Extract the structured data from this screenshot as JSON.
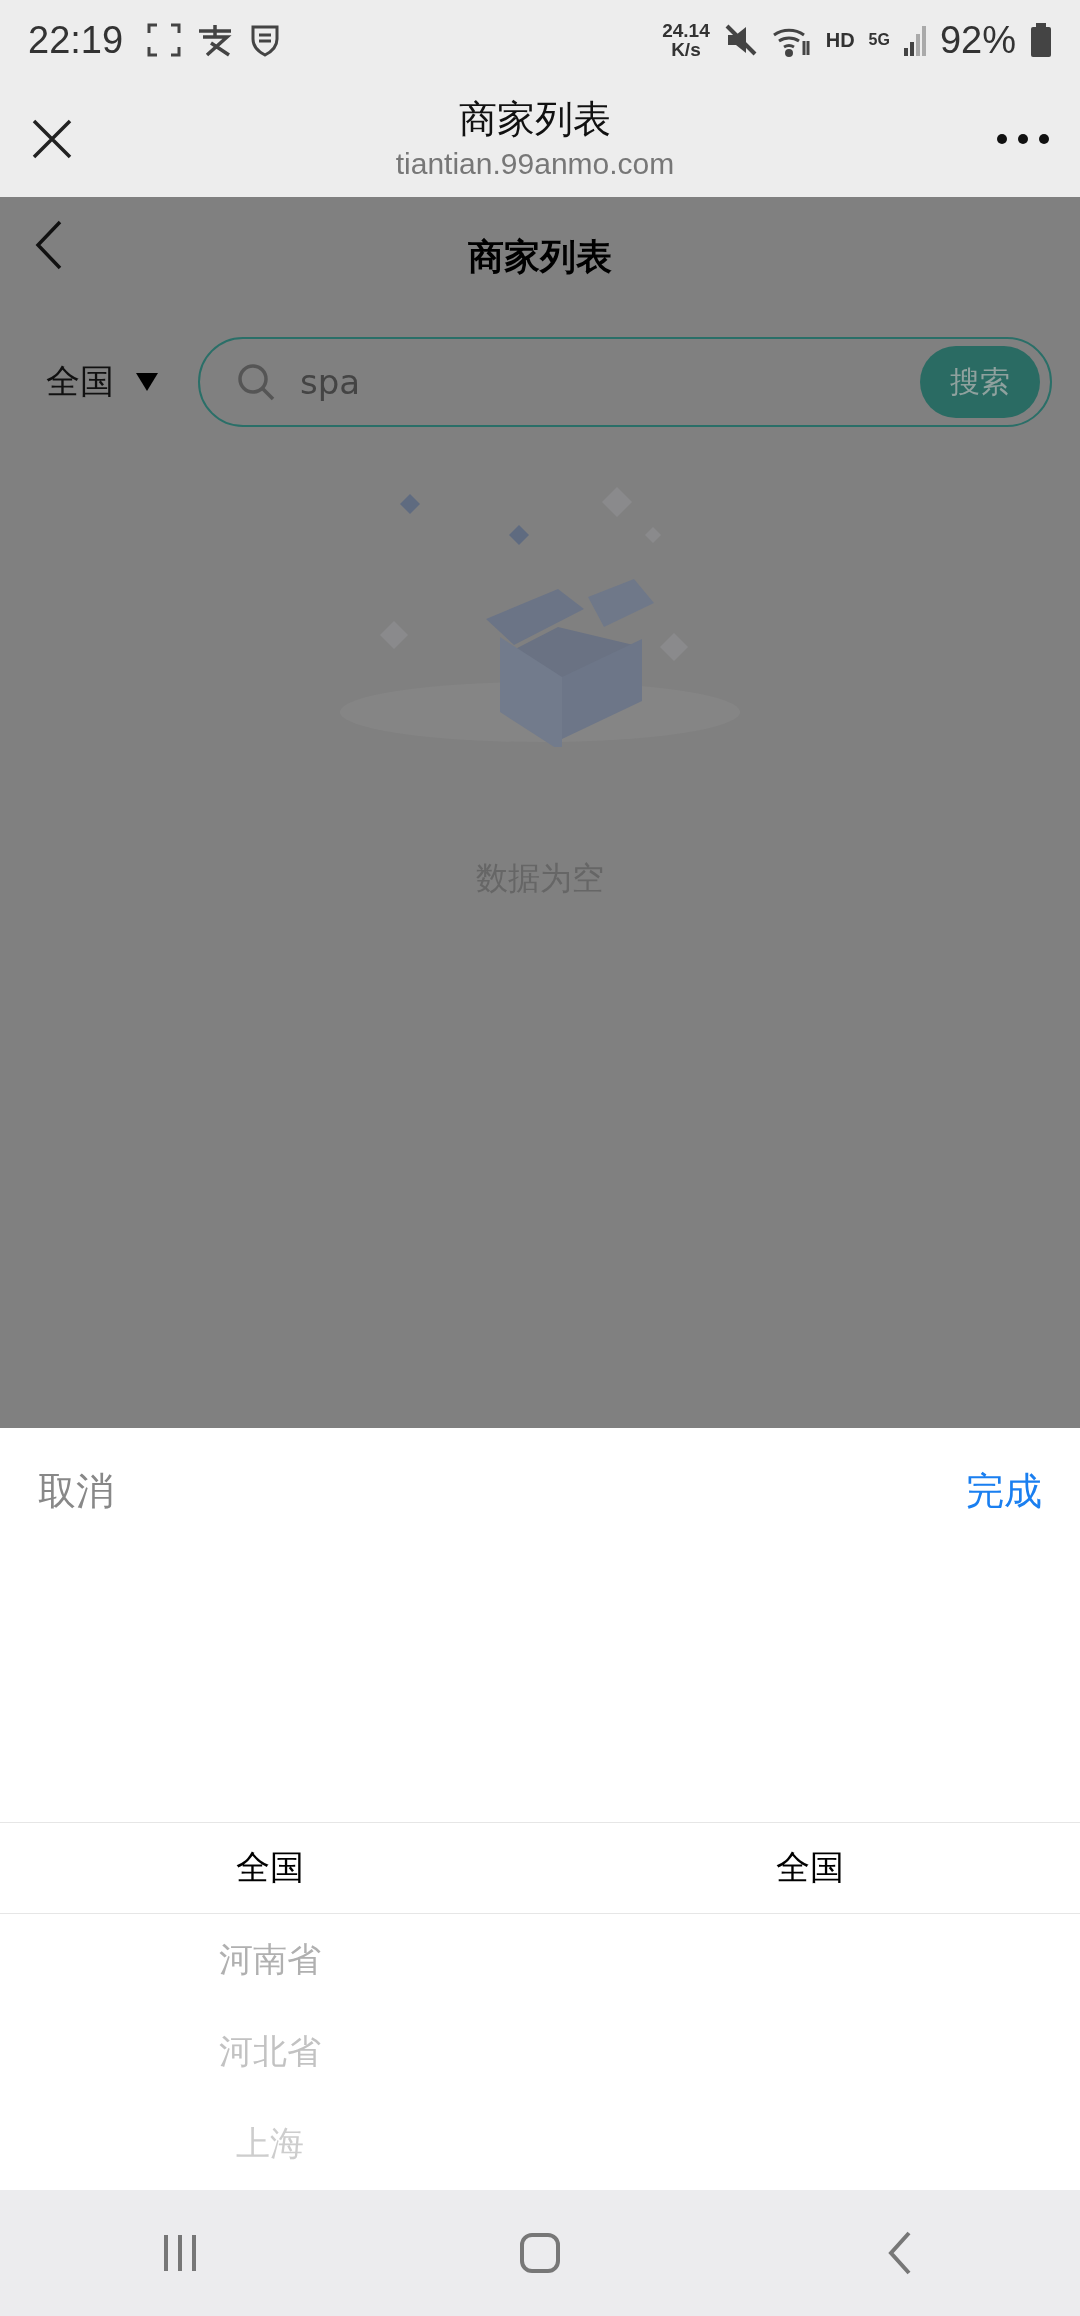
{
  "status_bar": {
    "time": "22:19",
    "net_speed": "24.14",
    "net_unit": "K/s",
    "hd": "HD",
    "network": "5G",
    "battery": "92%"
  },
  "browser": {
    "title": "商家列表",
    "url": "tiantian.99anmo.com"
  },
  "page": {
    "title": "商家列表",
    "region": "全国",
    "search": {
      "value": "spa",
      "button": "搜索"
    },
    "empty_text": "数据为空"
  },
  "picker": {
    "cancel": "取消",
    "confirm": "完成",
    "columns": [
      {
        "items": [
          {
            "label": "全国",
            "selected": true
          },
          {
            "label": "河南省",
            "selected": false
          },
          {
            "label": "河北省",
            "selected": false
          },
          {
            "label": "上海",
            "selected": false
          }
        ]
      },
      {
        "items": [
          {
            "label": "全国",
            "selected": true
          }
        ]
      }
    ]
  }
}
